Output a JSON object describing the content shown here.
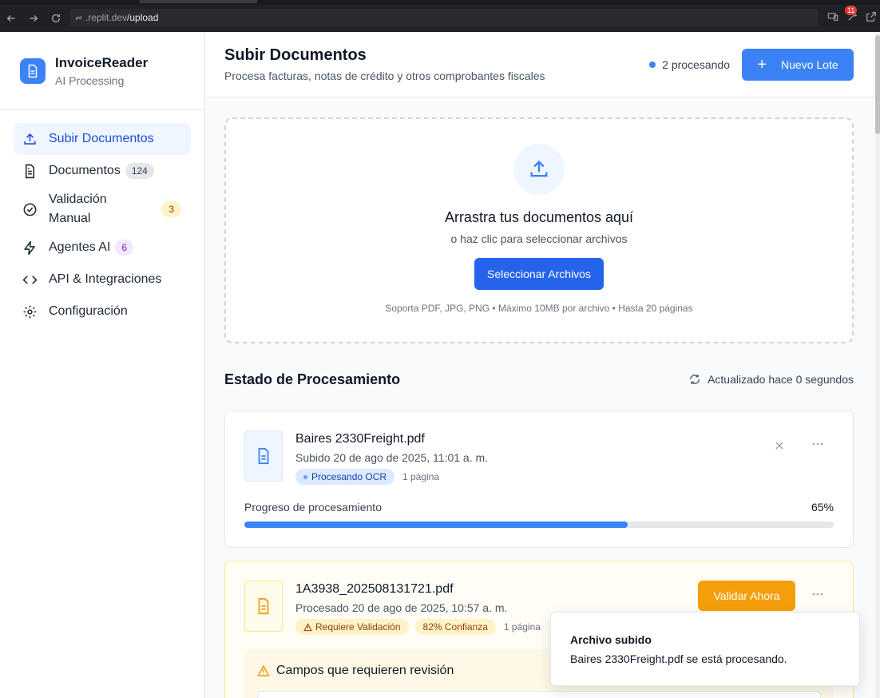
{
  "browser": {
    "url_host": ".replit.dev",
    "url_path": "/upload",
    "extension_badge": "11"
  },
  "brand": {
    "name": "InvoiceReader",
    "subtitle": "AI Processing"
  },
  "sidebar": {
    "items": [
      {
        "label": "Subir Documentos",
        "icon": "upload-icon",
        "active": true
      },
      {
        "label": "Documentos",
        "icon": "document-icon",
        "badge": "124"
      },
      {
        "label": "Validación Manual",
        "icon": "check-circle-icon",
        "badge": "3"
      },
      {
        "label": "Agentes AI",
        "icon": "bolt-icon",
        "badge": "6"
      },
      {
        "label": "API & Integraciones",
        "icon": "code-icon"
      },
      {
        "label": "Configuración",
        "icon": "gear-icon"
      }
    ]
  },
  "header": {
    "title": "Subir Documentos",
    "subtitle": "Procesa facturas, notas de crédito y otros comprobantes fiscales",
    "processing_status": "2 procesando",
    "new_batch_label": "Nuevo Lote"
  },
  "dropzone": {
    "title": "Arrastra tus documentos aquí",
    "subtitle": "o haz clic para seleccionar archivos",
    "button_label": "Seleccionar Archivos",
    "note": "Soporta PDF, JPG, PNG • Máximo 10MB por archivo • Hasta 20 páginas"
  },
  "status": {
    "title": "Estado de Procesamiento",
    "updated": "Actualizado hace 0 segundos"
  },
  "files": [
    {
      "name": "Baires 2330Freight.pdf",
      "meta": "Subido 20 de ago de 2025, 11:01 a. m.",
      "tag": "Procesando OCR",
      "pages": "1 página",
      "progress_label": "Progreso de procesamiento",
      "progress_text": "65%",
      "progress": 0.65
    },
    {
      "name": "1A3938_202508131721.pdf",
      "meta": "Procesado 20 de ago de 2025, 10:57 a. m.",
      "tag": "Requiere Validación",
      "confidence": "82% Confianza",
      "pages": "1 página",
      "action_label": "Validar Ahora",
      "review_title": "Campos que requieren revisión"
    }
  ],
  "toast": {
    "title": "Archivo subido",
    "message": "Baires 2330Freight.pdf se está procesando."
  },
  "colors": {
    "primary": "#3b82f6",
    "warning": "#f59e0b",
    "processing": "#dbeafe"
  }
}
